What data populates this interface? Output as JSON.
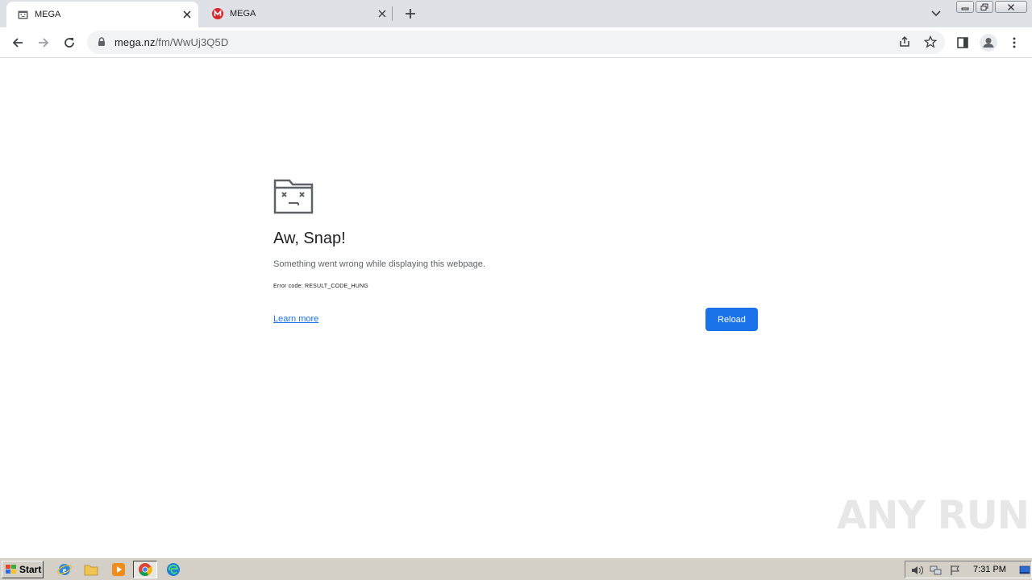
{
  "browser": {
    "tabs": [
      {
        "title": "MEGA",
        "active": true,
        "favicon": "sad-page-icon"
      },
      {
        "title": "MEGA",
        "active": false,
        "favicon": "mega-logo-icon"
      }
    ],
    "url_host": "mega.nz",
    "url_path": "/fm/WwUj3Q5D"
  },
  "error_page": {
    "title": "Aw, Snap!",
    "message": "Something went wrong while displaying this webpage.",
    "error_code": "Error code: RESULT_CODE_HUNG",
    "learn_more": "Learn more",
    "reload": "Reload"
  },
  "watermark": "ANY RUN",
  "taskbar": {
    "start": "Start",
    "clock": "7:31 PM"
  },
  "colors": {
    "accent": "#1a73e8",
    "tabstrip": "#dee1e6",
    "mega_red": "#d9272e"
  }
}
